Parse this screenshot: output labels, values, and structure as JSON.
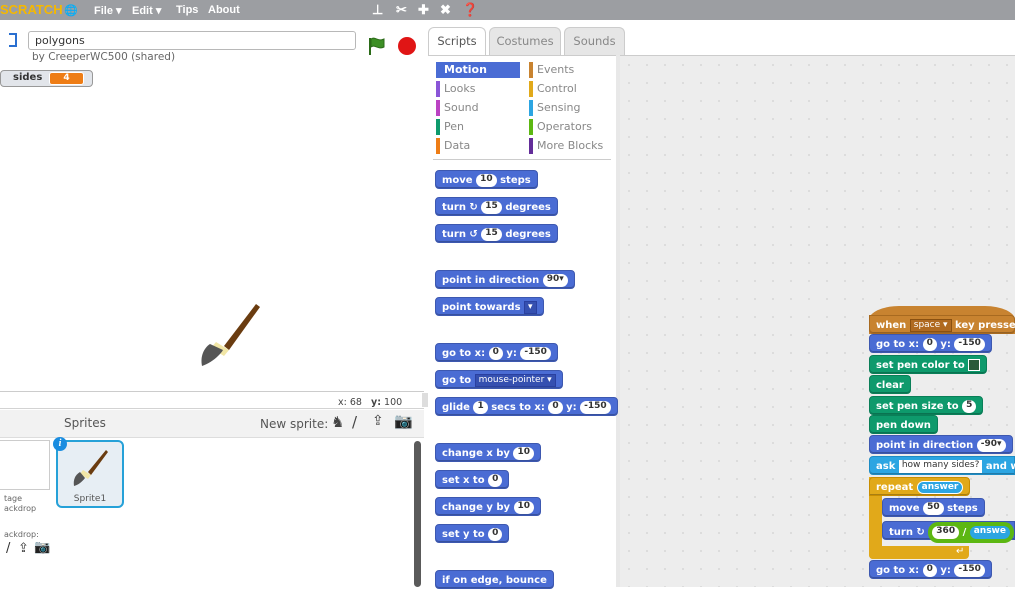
{
  "menubar": {
    "logo": "SCRATCH",
    "items": [
      "File ▾",
      "Edit ▾",
      "Tips",
      "About"
    ]
  },
  "project": {
    "title": "polygons",
    "author": "by CreeperWC500 (shared)"
  },
  "monitor": {
    "label": "sides",
    "value": "4"
  },
  "coords": {
    "x_label": "x:",
    "x": "68",
    "y_label": "y:",
    "y": "100"
  },
  "sprites": {
    "title": "Sprites",
    "new_sprite": "New sprite:",
    "stage_label": "tage\nackdrop",
    "backdrop_label": "ackdrop:",
    "sprite1": "Sprite1"
  },
  "tabs": [
    "Scripts",
    "Costumes",
    "Sounds"
  ],
  "categories": [
    "Motion",
    "Looks",
    "Sound",
    "Pen",
    "Data",
    "Events",
    "Control",
    "Sensing",
    "Operators",
    "More Blocks"
  ],
  "palette": {
    "move": [
      "move",
      "10",
      "steps"
    ],
    "turn_cw": [
      "turn ↻",
      "15",
      "degrees"
    ],
    "turn_ccw": [
      "turn ↺",
      "15",
      "degrees"
    ],
    "point_dir": [
      "point in direction",
      "90▾"
    ],
    "point_towards": [
      "point towards",
      "▾"
    ],
    "goto_xy": [
      "go to x:",
      "0",
      "y:",
      "-150"
    ],
    "goto": [
      "go to",
      "mouse-pointer ▾"
    ],
    "glide": [
      "glide",
      "1",
      "secs to x:",
      "0",
      "y:",
      "-150"
    ],
    "change_x": [
      "change x by",
      "10"
    ],
    "set_x": [
      "set x to",
      "0"
    ],
    "change_y": [
      "change y by",
      "10"
    ],
    "set_y": [
      "set y to",
      "0"
    ],
    "bounce": "if on edge, bounce"
  },
  "script": {
    "hat": [
      "when",
      "space ▾",
      "key presse"
    ],
    "goto_xy": [
      "go to x:",
      "0",
      "y:",
      "-150"
    ],
    "pen_color": "set pen color to",
    "clear": "clear",
    "pen_size": [
      "set pen size to",
      "5"
    ],
    "pen_down": "pen down",
    "point_dir": [
      "point in direction",
      "-90▾"
    ],
    "ask": [
      "ask",
      "how many sides?",
      "and w"
    ],
    "repeat": [
      "repeat",
      "answer"
    ],
    "move": [
      "move",
      "50",
      "steps"
    ],
    "turn": [
      "turn ↻",
      "360",
      "/",
      "answe"
    ],
    "goto_end": [
      "go to x:",
      "0",
      "y:",
      "-150"
    ]
  }
}
